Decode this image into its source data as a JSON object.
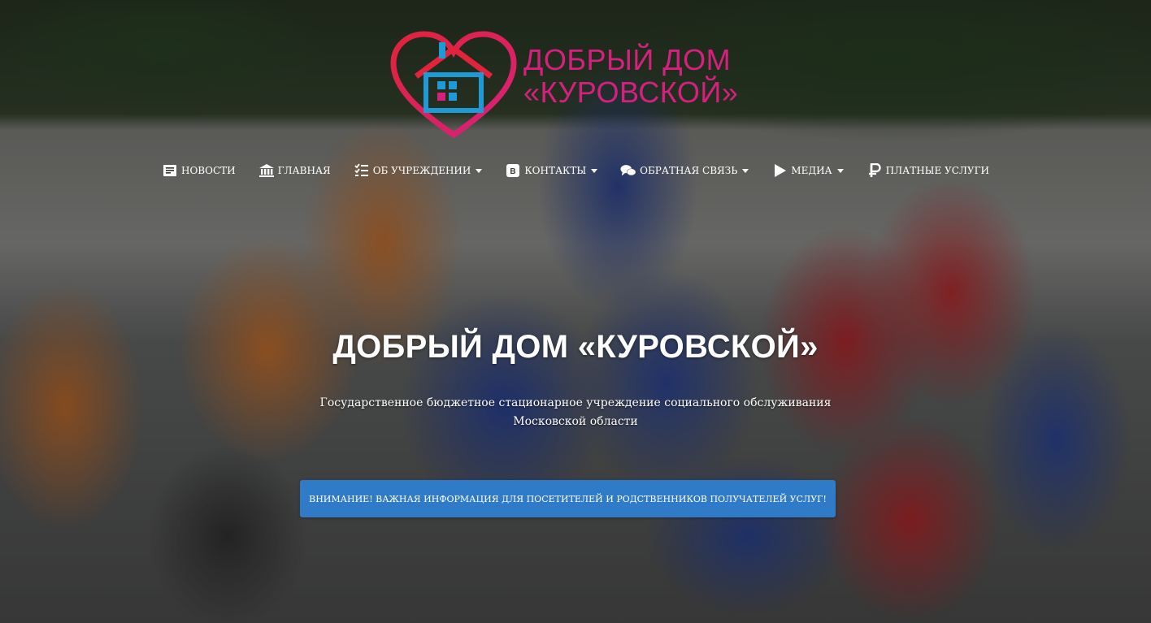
{
  "logo": {
    "line1": "ДОБРЫЙ ДОМ",
    "line2": "«КУРОВСКОЙ»"
  },
  "nav": {
    "items": [
      {
        "label": "НОВОСТИ",
        "icon": "newspaper-icon"
      },
      {
        "label": "ГЛАВНАЯ",
        "icon": "institution-icon"
      },
      {
        "label": "ОБ УЧРЕЖДЕНИИ",
        "icon": "list-check-icon",
        "dropdown": true
      },
      {
        "label": "КОНТАКТЫ",
        "icon": "vk-icon",
        "dropdown": true
      },
      {
        "label": "ОБРАТНАЯ СВЯЗЬ",
        "icon": "chat-bubbles-icon",
        "dropdown": true
      },
      {
        "label": "МЕДИА",
        "icon": "play-icon",
        "dropdown": true
      },
      {
        "label": "ПЛАТНЫЕ УСЛУГИ",
        "icon": "ruble-icon"
      }
    ]
  },
  "hero": {
    "title": "ДОБРЫЙ ДОМ «КУРОВСКОЙ»",
    "subtitle_line1": "Государственное бюджетное стационарное учреждение социального обслуживания",
    "subtitle_line2": "Московской области",
    "notice_button": "ВНИМАНИЕ! ВАЖНАЯ ИНФОРМАЦИЯ ДЛЯ ПОСЕТИТЕЛЕЙ И РОДСТВЕННИКОВ ПОЛУЧАТЕЛЕЙ УСЛУГ!"
  },
  "colors": {
    "brand_pink": "#d6207e",
    "brand_blue": "#1e9ad6",
    "button_blue": "#2f7bc8"
  }
}
